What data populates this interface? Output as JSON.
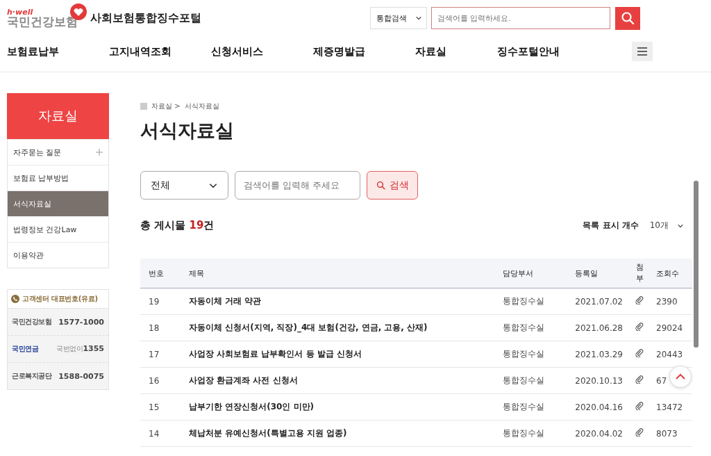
{
  "header": {
    "logo_tagline": "h·well",
    "logo_name": "국민건강보험",
    "portal_title": "사회보험통합징수포털",
    "search_scope": "통합검색",
    "search_placeholder": "검색어를 입력하세요."
  },
  "nav": [
    {
      "label": "보험료납부"
    },
    {
      "label": "고지내역조회"
    },
    {
      "label": "신청서비스"
    },
    {
      "label": "제증명발급"
    },
    {
      "label": "자료실"
    },
    {
      "label": "징수포털안내"
    }
  ],
  "sidebar": {
    "title": "자료실",
    "items": [
      {
        "label": "자주묻는 질문",
        "selected": false,
        "expandable": true
      },
      {
        "label": "보험료 납부방법",
        "selected": false,
        "expandable": false
      },
      {
        "label": "서식자료실",
        "selected": true,
        "expandable": false
      },
      {
        "label": "법령정보 건강Law",
        "selected": false,
        "expandable": false
      },
      {
        "label": "이용약관",
        "selected": false,
        "expandable": false
      }
    ]
  },
  "contact": {
    "title": "고객센터 대표번호(유료)",
    "entries": [
      {
        "kind": "nhis",
        "org": "국민건강보험",
        "number": "1577-1000"
      },
      {
        "kind": "nps",
        "org": "국민연금",
        "prefix": "국번없이",
        "number": "1355"
      },
      {
        "kind": "comwel",
        "org": "근로복지공단",
        "number": "1588-0075"
      }
    ]
  },
  "breadcrumb": [
    "자료실 >",
    "서식자료실"
  ],
  "page_title": "서식자료실",
  "filter": {
    "category": "전체",
    "placeholder": "검색어를 입력해 주세요",
    "button": "검색"
  },
  "summary": {
    "label": "총 게시물 **19**건",
    "page_size_label": "목록 표시 개수",
    "page_size": "10개"
  },
  "table": {
    "columns": [
      "번호",
      "제목",
      "담당부서",
      "등록일",
      "첨부",
      "조회수"
    ],
    "rows": [
      {
        "no": "19",
        "title": "자동이체 거래 약관",
        "dept": "통합징수실",
        "date": "2021.07.02",
        "attachment": true,
        "views": "2390"
      },
      {
        "no": "18",
        "title": "자동이체 신청서(지역, 직장)_4대 보험(건강, 연금, 고용, 산재)",
        "dept": "통합징수실",
        "date": "2021.06.28",
        "attachment": true,
        "views": "29024"
      },
      {
        "no": "17",
        "title": "사업장 사회보험료 납부확인서 등 발급 신청서",
        "dept": "통합징수실",
        "date": "2021.03.29",
        "attachment": true,
        "views": "20443"
      },
      {
        "no": "16",
        "title": "사업장 환급계좌 사전 신청서",
        "dept": "통합징수실",
        "date": "2020.10.13",
        "attachment": true,
        "views": "67"
      },
      {
        "no": "15",
        "title": "납부기한 연장신청서(30인 미만)",
        "dept": "통합징수실",
        "date": "2020.04.16",
        "attachment": true,
        "views": "13472"
      },
      {
        "no": "14",
        "title": "체납처분 유예신청서(특별고용 지원 업종)",
        "dept": "통합징수실",
        "date": "2020.04.02",
        "attachment": true,
        "views": "8073"
      }
    ]
  }
}
